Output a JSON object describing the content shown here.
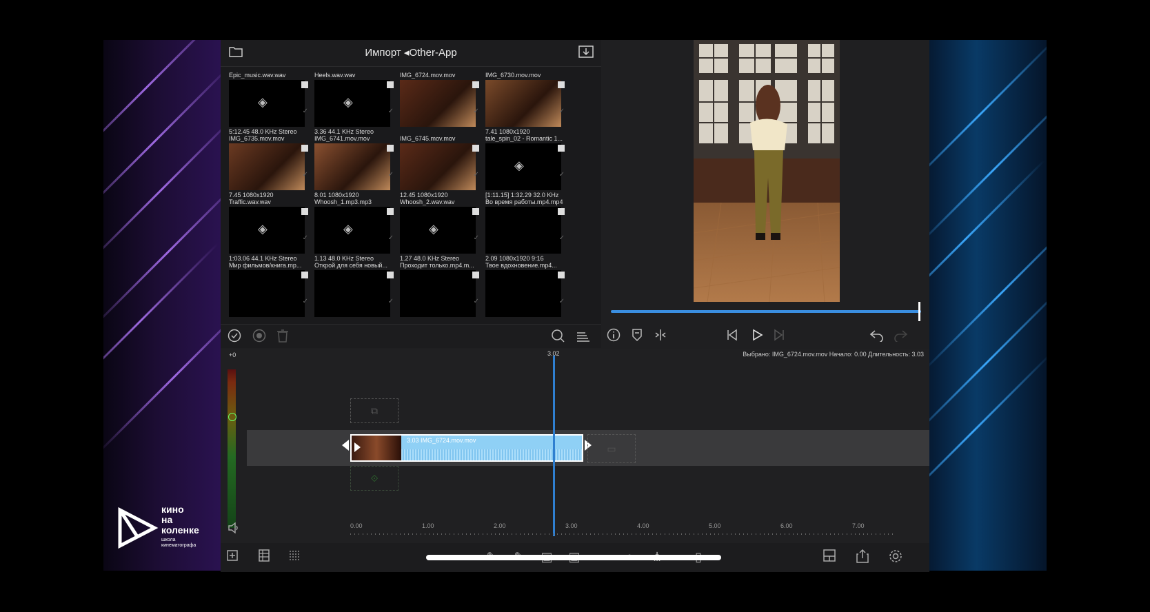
{
  "logo": {
    "line1": "кино",
    "line2": "на",
    "line3": "коленке",
    "tag1": "школа",
    "tag2": "кинематографа"
  },
  "browser": {
    "title": "Импорт ◂Other-App",
    "items": [
      {
        "name": "Epic_music.wav.wav",
        "meta": "5:12.45  48.0 KHz  Stereo",
        "kind": "audio"
      },
      {
        "name": "Heels.wav.wav",
        "meta": "3.36  44.1 KHz  Stereo",
        "kind": "audio"
      },
      {
        "name": "IMG_6724.mov.mov",
        "meta": "",
        "kind": "video"
      },
      {
        "name": "IMG_6730.mov.mov",
        "meta": "7.41  1080x1920",
        "kind": "video"
      },
      {
        "name": "IMG_6735.mov.mov",
        "meta": "7.45  1080x1920",
        "kind": "video"
      },
      {
        "name": "IMG_6741.mov.mov",
        "meta": "8.01  1080x1920",
        "kind": "video"
      },
      {
        "name": "IMG_6745.mov.mov",
        "meta": "12.45  1080x1920",
        "kind": "video"
      },
      {
        "name": "tale_spin_02 - Romantic 1...",
        "meta": "[1:11.15]  1:32.29  32.0 KHz",
        "kind": "audio"
      },
      {
        "name": "Traffic.wav.wav",
        "meta": "1:03.06  44.1 KHz  Stereo",
        "kind": "audio"
      },
      {
        "name": "Whoosh_1.mp3.mp3",
        "meta": "1.13  48.0 KHz  Stereo",
        "kind": "audio"
      },
      {
        "name": "Whoosh_2.wav.wav",
        "meta": "1.27  48.0 KHz  Stereo",
        "kind": "audio"
      },
      {
        "name": "Во время работы.mp4.mp4",
        "meta": "2.09  1080x1920  9:16",
        "kind": "video-dark"
      },
      {
        "name": "Мир фильмов/книга.mp...",
        "meta": "",
        "kind": "video-dark"
      },
      {
        "name": "Открой для себя новый...",
        "meta": "",
        "kind": "video-dark"
      },
      {
        "name": "Проходит только.mp4.m...",
        "meta": "",
        "kind": "video-dark"
      },
      {
        "name": "Твое вдохновение.mp4...",
        "meta": "",
        "kind": "video-dark"
      }
    ]
  },
  "timeline": {
    "playhead_time": "3.02",
    "selection_info": "Выбрано: IMG_6724.mov.mov Начало: 0.00 Длительность: 3.03",
    "db_label": "+0",
    "clip_label": "3.03  IMG_6724.mov.mov",
    "ruler": [
      "0.00",
      "1.00",
      "2.00",
      "3.00",
      "4.00",
      "5.00",
      "6.00",
      "7.00"
    ]
  },
  "colors": {
    "accent": "#3a8ee0",
    "clip": "#8fd0f5",
    "app_bg": "#1f1f21"
  }
}
